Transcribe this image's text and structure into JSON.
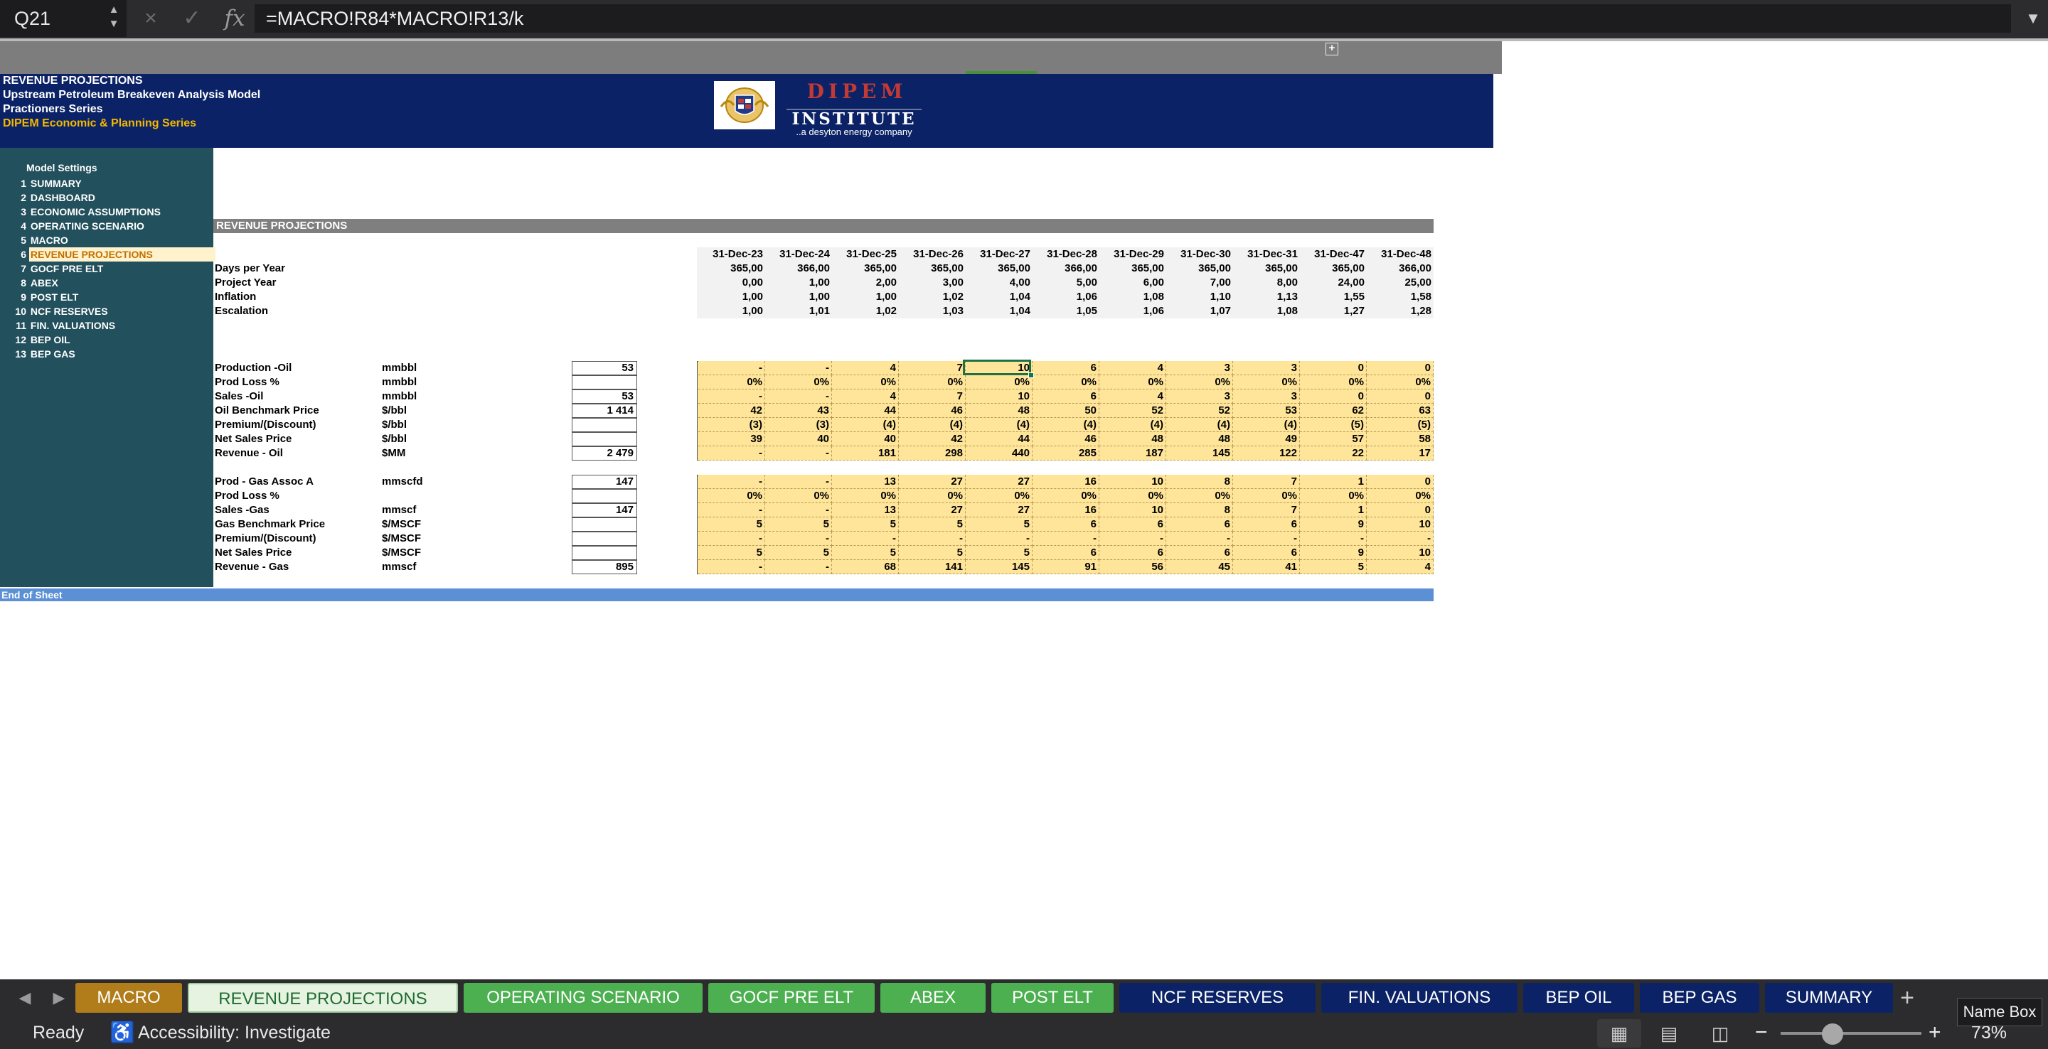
{
  "formula_bar": {
    "cell_ref": "Q21",
    "formula": "=MACRO!R84*MACRO!R13/k",
    "cancel_icon": "×",
    "confirm_icon": "✓",
    "fx_label": "fx"
  },
  "banner": {
    "lines": [
      "REVENUE PROJECTIONS",
      "Upstream Petroleum Breakeven Analysis Model",
      "Practioners Series",
      "DIPEM Economic & Planning Series"
    ],
    "logo_top": "DIPEM",
    "logo_bottom": "INSTITUTE",
    "logo_tagline": "..a desyton energy company",
    "colors": {
      "navy": "#0b2366",
      "accent": "#c23a35",
      "tagline": "#f5b800"
    }
  },
  "sidebar": {
    "title": "Model  Settings",
    "items": [
      {
        "num": "1",
        "label": "SUMMARY"
      },
      {
        "num": "2",
        "label": "DASHBOARD"
      },
      {
        "num": "3",
        "label": "ECONOMIC ASSUMPTIONS"
      },
      {
        "num": "4",
        "label": "OPERATING SCENARIO"
      },
      {
        "num": "5",
        "label": "MACRO"
      },
      {
        "num": "6",
        "label": "REVENUE PROJECTIONS"
      },
      {
        "num": "7",
        "label": "GOCF  PRE ELT"
      },
      {
        "num": "8",
        "label": "ABEX"
      },
      {
        "num": "9",
        "label": "POST ELT"
      },
      {
        "num": "10",
        "label": "NCF RESERVES"
      },
      {
        "num": "11",
        "label": "FIN. VALUATIONS"
      },
      {
        "num": "12",
        "label": "BEP OIL"
      },
      {
        "num": "13",
        "label": "BEP GAS"
      }
    ]
  },
  "sheet": {
    "section_title": "REVENUE PROJECTIONS",
    "dates": [
      "31-Dec-23",
      "31-Dec-24",
      "31-Dec-25",
      "31-Dec-26",
      "31-Dec-27",
      "31-Dec-28",
      "31-Dec-29",
      "31-Dec-30",
      "31-Dec-31",
      "31-Dec-47",
      "31-Dec-48"
    ],
    "header_rows": [
      {
        "label": "Days per Year",
        "values": [
          "365,00",
          "366,00",
          "365,00",
          "365,00",
          "365,00",
          "366,00",
          "365,00",
          "365,00",
          "365,00",
          "365,00",
          "366,00"
        ]
      },
      {
        "label": "Project Year",
        "values": [
          "0,00",
          "1,00",
          "2,00",
          "3,00",
          "4,00",
          "5,00",
          "6,00",
          "7,00",
          "8,00",
          "24,00",
          "25,00"
        ]
      },
      {
        "label": "Inflation",
        "values": [
          "1,00",
          "1,00",
          "1,00",
          "1,02",
          "1,04",
          "1,06",
          "1,08",
          "1,10",
          "1,13",
          "1,55",
          "1,58"
        ]
      },
      {
        "label": "Escalation",
        "values": [
          "1,00",
          "1,01",
          "1,02",
          "1,03",
          "1,04",
          "1,05",
          "1,06",
          "1,07",
          "1,08",
          "1,27",
          "1,28"
        ]
      }
    ],
    "oil_rows": [
      {
        "label": "Production -Oil",
        "unit": "mmbbl",
        "total": "53",
        "values": [
          "-",
          "-",
          "4",
          "7",
          "10",
          "6",
          "4",
          "3",
          "3",
          "0",
          "0"
        ]
      },
      {
        "label": "Prod Loss %",
        "unit": "mmbbl",
        "total": "",
        "values": [
          "0%",
          "0%",
          "0%",
          "0%",
          "0%",
          "0%",
          "0%",
          "0%",
          "0%",
          "0%",
          "0%"
        ]
      },
      {
        "label": "Sales -Oil",
        "unit": "mmbbl",
        "total": "53",
        "values": [
          "-",
          "-",
          "4",
          "7",
          "10",
          "6",
          "4",
          "3",
          "3",
          "0",
          "0"
        ]
      },
      {
        "label": "Oil Benchmark Price",
        "unit": "$/bbl",
        "total": "1 414",
        "values": [
          "42",
          "43",
          "44",
          "46",
          "48",
          "50",
          "52",
          "52",
          "53",
          "62",
          "63"
        ]
      },
      {
        "label": "Premium/(Discount)",
        "unit": "$/bbl",
        "total": "",
        "values": [
          "(3)",
          "(3)",
          "(4)",
          "(4)",
          "(4)",
          "(4)",
          "(4)",
          "(4)",
          "(4)",
          "(5)",
          "(5)"
        ]
      },
      {
        "label": "Net Sales Price",
        "unit": "$/bbl",
        "total": "",
        "values": [
          "39",
          "40",
          "40",
          "42",
          "44",
          "46",
          "48",
          "48",
          "49",
          "57",
          "58"
        ]
      },
      {
        "label": "Revenue - Oil",
        "unit": "$MM",
        "total": "2 479",
        "values": [
          "-",
          "-",
          "181",
          "298",
          "440",
          "285",
          "187",
          "145",
          "122",
          "22",
          "17"
        ]
      }
    ],
    "gas_rows": [
      {
        "label": "Prod - Gas Assoc A",
        "unit": "mmscfd",
        "total": "147",
        "values": [
          "-",
          "-",
          "13",
          "27",
          "27",
          "16",
          "10",
          "8",
          "7",
          "1",
          "0"
        ]
      },
      {
        "label": "Prod Loss %",
        "unit": "",
        "total": "",
        "values": [
          "0%",
          "0%",
          "0%",
          "0%",
          "0%",
          "0%",
          "0%",
          "0%",
          "0%",
          "0%",
          "0%"
        ]
      },
      {
        "label": "Sales -Gas",
        "unit": "mmscf",
        "total": "147",
        "values": [
          "-",
          "-",
          "13",
          "27",
          "27",
          "16",
          "10",
          "8",
          "7",
          "1",
          "0"
        ]
      },
      {
        "label": "Gas  Benchmark Price",
        "unit": "$/MSCF",
        "total": "",
        "values": [
          "5",
          "5",
          "5",
          "5",
          "5",
          "6",
          "6",
          "6",
          "6",
          "9",
          "10"
        ]
      },
      {
        "label": "Premium/(Discount)",
        "unit": "$/MSCF",
        "total": "",
        "values": [
          "-",
          "-",
          "-",
          "-",
          "-",
          "-",
          "-",
          "-",
          "-",
          "-",
          "-"
        ]
      },
      {
        "label": "Net Sales Price",
        "unit": "$/MSCF",
        "total": "",
        "values": [
          "5",
          "5",
          "5",
          "5",
          "5",
          "6",
          "6",
          "6",
          "6",
          "9",
          "10"
        ]
      },
      {
        "label": "Revenue - Gas",
        "unit": "mmscf",
        "total": "895",
        "values": [
          "-",
          "-",
          "68",
          "141",
          "145",
          "91",
          "56",
          "45",
          "41",
          "5",
          "4"
        ]
      }
    ],
    "end_label": "End of Sheet"
  },
  "tabs": [
    {
      "label": "MACRO",
      "bg": "#b07d1a"
    },
    {
      "label": "REVENUE PROJECTIONS",
      "bg": "#e6f3e0",
      "active": true
    },
    {
      "label": "OPERATING SCENARIO",
      "bg": "#4caf50"
    },
    {
      "label": "GOCF  PRE ELT",
      "bg": "#4caf50"
    },
    {
      "label": "ABEX",
      "bg": "#4caf50"
    },
    {
      "label": "POST ELT",
      "bg": "#4caf50"
    },
    {
      "label": "NCF RESERVES",
      "bg": "#0b2366"
    },
    {
      "label": "FIN. VALUATIONS",
      "bg": "#0b2366"
    },
    {
      "label": "BEP OIL",
      "bg": "#0b2366"
    },
    {
      "label": "BEP GAS",
      "bg": "#0b2366"
    },
    {
      "label": "SUMMARY",
      "bg": "#0b2366"
    }
  ],
  "status": {
    "ready": "Ready",
    "accessibility": "Accessibility: Investigate",
    "zoom": "73%",
    "tooltip": "Name Box",
    "zoom_value": 0.42
  }
}
